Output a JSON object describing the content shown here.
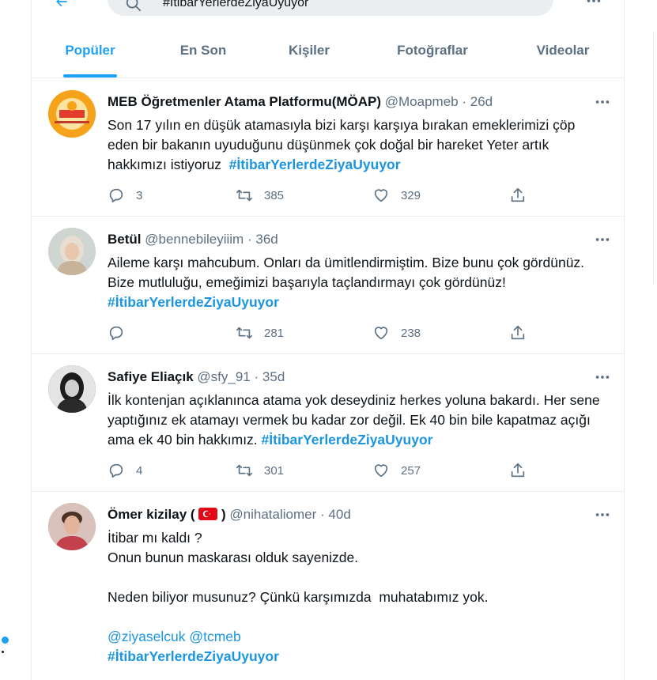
{
  "search": {
    "query": "#İtibarYerlerdeZiyaUyuyor"
  },
  "tabs": [
    {
      "label": "Popüler"
    },
    {
      "label": "En Son"
    },
    {
      "label": "Kişiler"
    },
    {
      "label": "Fotoğraflar"
    },
    {
      "label": "Videolar"
    }
  ],
  "tweets": [
    {
      "name": "MEB Öğretmenler Atama Platformu(MÖAP)",
      "handle": "@Moapmeb",
      "time": "26d",
      "text": "Son 17 yılın en düşük atamasıyla bizi karşı karşıya bırakan emeklerimizi çöp eden bir bakanın uyuduğunu düşünmek çok doğal bir hareket Yeter artık hakkımızı istiyoruz  ",
      "hashtag": "#İtibarYerlerdeZiyaUyuyor",
      "replies": "3",
      "retweets": "385",
      "likes": "329"
    },
    {
      "name": "Betül",
      "handle": "@bennebileyiiim",
      "time": "36d",
      "text": "Aileme karşı mahcubum. Onları da ümitlendirmiştim. Bize bunu çok gördünüz. Bize mutluluğu, emeğimizi başarıyla taçlandırmayı çok gördünüz!",
      "hashtag": "#İtibarYerlerdeZiyaUyuyor",
      "replies": "",
      "retweets": "281",
      "likes": "238"
    },
    {
      "name": "Safiye Eliaçık",
      "handle": "@sfy_91",
      "time": "35d",
      "text": "İlk kontenjan açıklanınca atama yok deseydiniz herkes yoluna bakardı. Her sene yaptığınız ek atamayı vermek bu kadar zor değil. Ek 40 bin bile kapatmaz açığı ama ek 40 bin hakkımız. ",
      "hashtag": "#İtibarYerlerdeZiyaUyuyor",
      "replies": "4",
      "retweets": "301",
      "likes": "257"
    },
    {
      "name": "Ömer kizilay ( ",
      "name_end": " )",
      "handle": "@nihataliomer",
      "time": "40d",
      "text": "İtibar mı kaldı ?\nOnun bunun maskarası olduk sayenizde.\n\nNeden biliyor musunuz? Çünkü karşımızda  muhatabımız yok.",
      "mentions": "@ziyaselcuk @tcmeb",
      "hashtag": "#İtibarYerlerdeZiyaUyuyor"
    }
  ],
  "colors": {
    "accent": "#1da1f2",
    "link": "#1b95e0",
    "muted": "#5b7083",
    "border": "#ebeef0"
  },
  "icons": [
    "back-arrow-icon",
    "search-icon",
    "more-icon",
    "reply-icon",
    "retweet-icon",
    "like-icon",
    "share-icon",
    "turkey-flag-icon"
  ]
}
